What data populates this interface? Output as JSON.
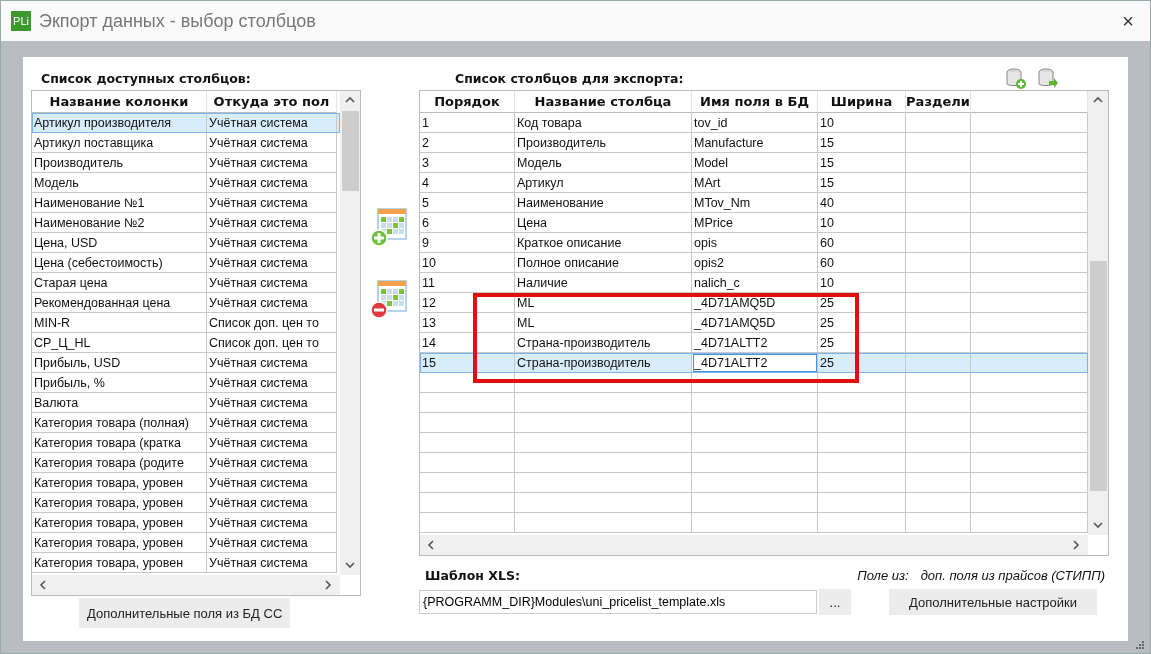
{
  "window": {
    "icon_text": "PLi",
    "title": "Экпорт данных - выбор столбцов",
    "close": "×"
  },
  "available": {
    "label": "Список доступных столбцов:",
    "columns": [
      "Название колонки",
      "Откуда это пол"
    ],
    "rows": [
      {
        "cells": [
          "Артикул производителя",
          "Учётная система"
        ],
        "selected": true
      },
      {
        "cells": [
          "Артикул поставщика",
          "Учётная система"
        ],
        "selected": false
      },
      {
        "cells": [
          "Производитель",
          "Учётная система"
        ],
        "selected": false
      },
      {
        "cells": [
          "Модель",
          "Учётная система"
        ],
        "selected": false
      },
      {
        "cells": [
          "Наименование №1",
          "Учётная система"
        ],
        "selected": false
      },
      {
        "cells": [
          "Наименование №2",
          "Учётная система"
        ],
        "selected": false
      },
      {
        "cells": [
          "Цена, USD",
          "Учётная система"
        ],
        "selected": false
      },
      {
        "cells": [
          "Цена (себестоимость)",
          "Учётная система"
        ],
        "selected": false
      },
      {
        "cells": [
          "Старая цена",
          "Учётная система"
        ],
        "selected": false
      },
      {
        "cells": [
          "Рекомендованная цена",
          "Учётная система"
        ],
        "selected": false
      },
      {
        "cells": [
          "MIN-R",
          "Список доп. цен то"
        ],
        "selected": false
      },
      {
        "cells": [
          "СР_Ц_HL",
          "Список доп. цен то"
        ],
        "selected": false
      },
      {
        "cells": [
          "Прибыль, USD",
          "Учётная система"
        ],
        "selected": false
      },
      {
        "cells": [
          "Прибыль, %",
          "Учётная система"
        ],
        "selected": false
      },
      {
        "cells": [
          "Валюта",
          "Учётная система"
        ],
        "selected": false
      },
      {
        "cells": [
          "Категория товара (полная)",
          "Учётная система"
        ],
        "selected": false
      },
      {
        "cells": [
          "Категория товара (кратка",
          "Учётная система"
        ],
        "selected": false
      },
      {
        "cells": [
          "Категория товара (родите",
          "Учётная система"
        ],
        "selected": false
      },
      {
        "cells": [
          "Категория товара, уровен",
          "Учётная система"
        ],
        "selected": false
      },
      {
        "cells": [
          "Категория товара, уровен",
          "Учётная система"
        ],
        "selected": false
      },
      {
        "cells": [
          "Категория товара, уровен",
          "Учётная система"
        ],
        "selected": false
      },
      {
        "cells": [
          "Категория товара, уровен",
          "Учётная система"
        ],
        "selected": false
      },
      {
        "cells": [
          "Категория товара, уровен",
          "Учётная система"
        ],
        "selected": false
      }
    ],
    "extra_button": "Дополнительные поля из БД СС"
  },
  "export": {
    "label": "Список столбцов для экспорта:",
    "columns": [
      "Порядок",
      "Название столбца",
      "Имя поля в БД",
      "Ширина",
      "Раздели"
    ],
    "rows": [
      {
        "cells": [
          "1",
          "Код товара",
          "tov_id",
          "10",
          ""
        ],
        "selected": false,
        "editing": false
      },
      {
        "cells": [
          "2",
          "Производитель",
          "Manufacture",
          "15",
          ""
        ],
        "selected": false,
        "editing": false
      },
      {
        "cells": [
          "3",
          "Модель",
          "Model",
          "15",
          ""
        ],
        "selected": false,
        "editing": false
      },
      {
        "cells": [
          "4",
          "Артикул",
          "MArt",
          "15",
          ""
        ],
        "selected": false,
        "editing": false
      },
      {
        "cells": [
          "5",
          "Наименование",
          "MTov_Nm",
          "40",
          ""
        ],
        "selected": false,
        "editing": false
      },
      {
        "cells": [
          "6",
          "Цена",
          "MPrice",
          "10",
          ""
        ],
        "selected": false,
        "editing": false
      },
      {
        "cells": [
          "9",
          "Краткое описание",
          "opis",
          "60",
          ""
        ],
        "selected": false,
        "editing": false
      },
      {
        "cells": [
          "10",
          "Полное описание",
          "opis2",
          "60",
          ""
        ],
        "selected": false,
        "editing": false
      },
      {
        "cells": [
          "11",
          "Наличие",
          "nalich_c",
          "10",
          ""
        ],
        "selected": false,
        "editing": false
      },
      {
        "cells": [
          "12",
          "ML",
          "_4D71AMQ5D",
          "25",
          ""
        ],
        "selected": false,
        "editing": false
      },
      {
        "cells": [
          "13",
          "ML",
          "_4D71AMQ5D",
          "25",
          ""
        ],
        "selected": false,
        "editing": false
      },
      {
        "cells": [
          "14",
          "Страна-производитель",
          "_4D71ALTT2",
          "25",
          ""
        ],
        "selected": false,
        "editing": false
      },
      {
        "cells": [
          "15",
          "Страна-производитель",
          "_4D71ALTT2",
          "25",
          ""
        ],
        "selected": true,
        "editing": true
      }
    ],
    "template_label": "Шаблон XLS:",
    "template_value": "{PROGRAMM_DIR}Modules\\uni_pricelist_template.xls",
    "browse_button": "...",
    "source_label": "Поле из:",
    "source_value": "доп. поля из прайсов (СТИПП)",
    "settings_button": "Дополнительные настройки"
  }
}
